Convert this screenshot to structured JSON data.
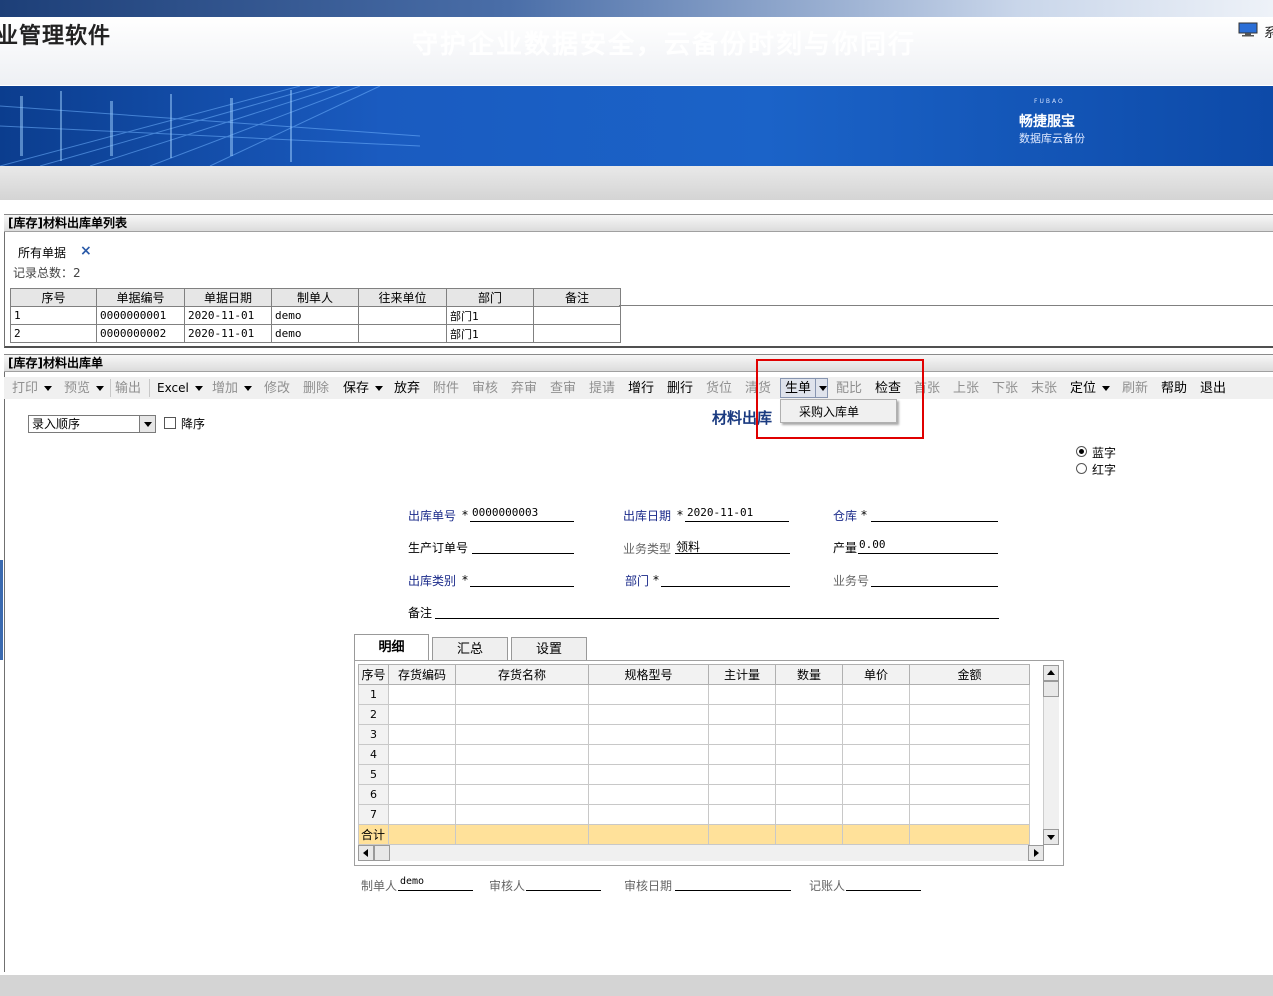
{
  "header": {
    "app_title": "业管理软件",
    "right_text_cut": "系"
  },
  "banner": {
    "slogan": "守护企业数据安全，云备份时刻与你同行",
    "brand_small": "FUBAO",
    "brand_name": "畅捷服宝",
    "brand_sub": "数据库云备份"
  },
  "list_panel": {
    "title": "[库存]材料出库单列表",
    "filter_chip": "所有单据",
    "filter_close": "×",
    "record_count": "记录总数：2",
    "columns": [
      "序号",
      "单据编号",
      "单据日期",
      "制单人",
      "往来单位",
      "部门",
      "备注"
    ],
    "rows": [
      [
        "1",
        "0000000001",
        "2020-11-01",
        "demo",
        "",
        "部门1",
        ""
      ],
      [
        "2",
        "0000000002",
        "2020-11-01",
        "demo",
        "",
        "部门1",
        ""
      ]
    ]
  },
  "form_panel": {
    "title": "[库存]材料出库单",
    "toolbar": {
      "print": "打印",
      "preview": "预览",
      "export": "输出",
      "excel": "Excel",
      "add": "增加",
      "edit": "修改",
      "delete": "删除",
      "save": "保存",
      "abandon": "放弃",
      "attach": "附件",
      "audit": "审核",
      "unaudit": "弃审",
      "check_audit": "查审",
      "request": "提请",
      "add_row": "增行",
      "del_row": "删行",
      "location": "货位",
      "clear": "清货",
      "generate": "生单",
      "ratio": "配比",
      "inspect": "检查",
      "first": "首张",
      "prev": "上张",
      "next": "下张",
      "last": "末张",
      "locate": "定位",
      "refresh": "刷新",
      "help": "帮助",
      "exit": "退出"
    },
    "generate_menu": [
      "采购入库单"
    ],
    "sort": {
      "selected": "录入顺序",
      "desc_label": "降序"
    },
    "form_title": "材料出库",
    "color_mode": {
      "blue": "蓝字",
      "red": "红字",
      "selected": "blue"
    },
    "fields": {
      "out_no_label": "出库单号",
      "out_no": "0000000003",
      "out_date_label": "出库日期",
      "out_date": "2020-11-01",
      "warehouse_label": "仓库",
      "prod_order_label": "生产订单号",
      "biz_type_label": "业务类型",
      "biz_type": "领料",
      "output_label": "产量",
      "output": "0.00",
      "out_category_label": "出库类别",
      "dept_label": "部门",
      "biz_no_label": "业务号",
      "remark_label": "备注",
      "required": "*"
    },
    "tabs": [
      "明细",
      "汇总",
      "设置"
    ],
    "detail_columns": [
      "序号",
      "存货编码",
      "存货名称",
      "规格型号",
      "主计量",
      "数量",
      "单价",
      "金额"
    ],
    "detail_rows": [
      "1",
      "2",
      "3",
      "4",
      "5",
      "6",
      "7"
    ],
    "total_label": "合计",
    "footer": {
      "maker_label": "制单人",
      "maker": "demo",
      "auditor_label": "审核人",
      "audit_date_label": "审核日期",
      "bookkeeper_label": "记账人"
    }
  }
}
